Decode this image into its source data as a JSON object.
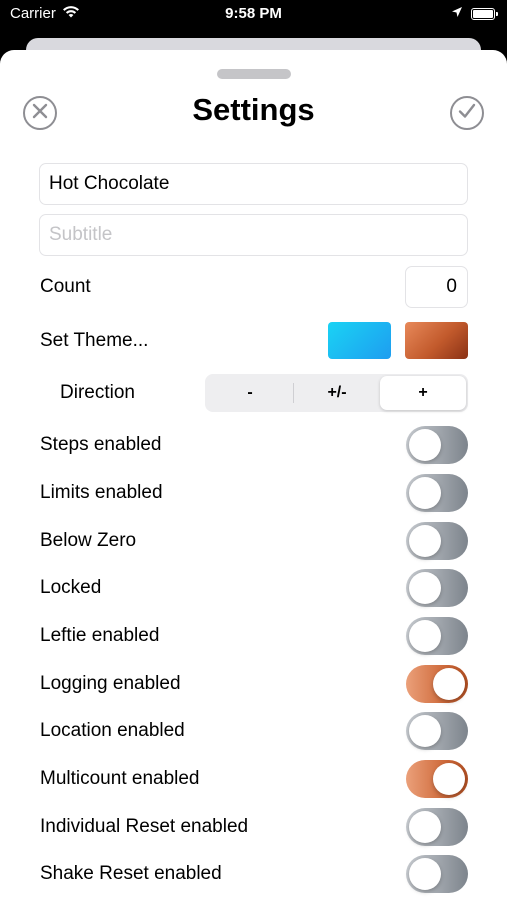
{
  "status_bar": {
    "carrier": "Carrier",
    "time": "9:58 PM"
  },
  "sheet": {
    "title": "Settings",
    "close_icon": "xmark-circle-icon",
    "done_icon": "checkmark-circle-icon"
  },
  "fields": {
    "title_value": "Hot Chocolate",
    "subtitle_placeholder": "Subtitle",
    "count_label": "Count",
    "count_value": "0"
  },
  "theme": {
    "label": "Set Theme...",
    "colors": [
      "#1ec0f2",
      "#b9542a"
    ]
  },
  "direction": {
    "label": "Direction",
    "options": [
      "-",
      "+/-",
      "+"
    ],
    "selected": "+"
  },
  "toggles": [
    {
      "label": "Steps enabled",
      "on": false
    },
    {
      "label": "Limits enabled",
      "on": false
    },
    {
      "label": "Below Zero",
      "on": false
    },
    {
      "label": "Locked",
      "on": false
    },
    {
      "label": "Leftie enabled",
      "on": false
    },
    {
      "label": "Logging enabled",
      "on": true
    },
    {
      "label": "Location enabled",
      "on": false
    },
    {
      "label": "Multicount enabled",
      "on": true
    },
    {
      "label": "Individual Reset enabled",
      "on": false
    },
    {
      "label": "Shake Reset enabled",
      "on": false
    }
  ],
  "colors": {
    "accent_on": "#cf6b3c",
    "toggle_off": "#8e949b"
  }
}
